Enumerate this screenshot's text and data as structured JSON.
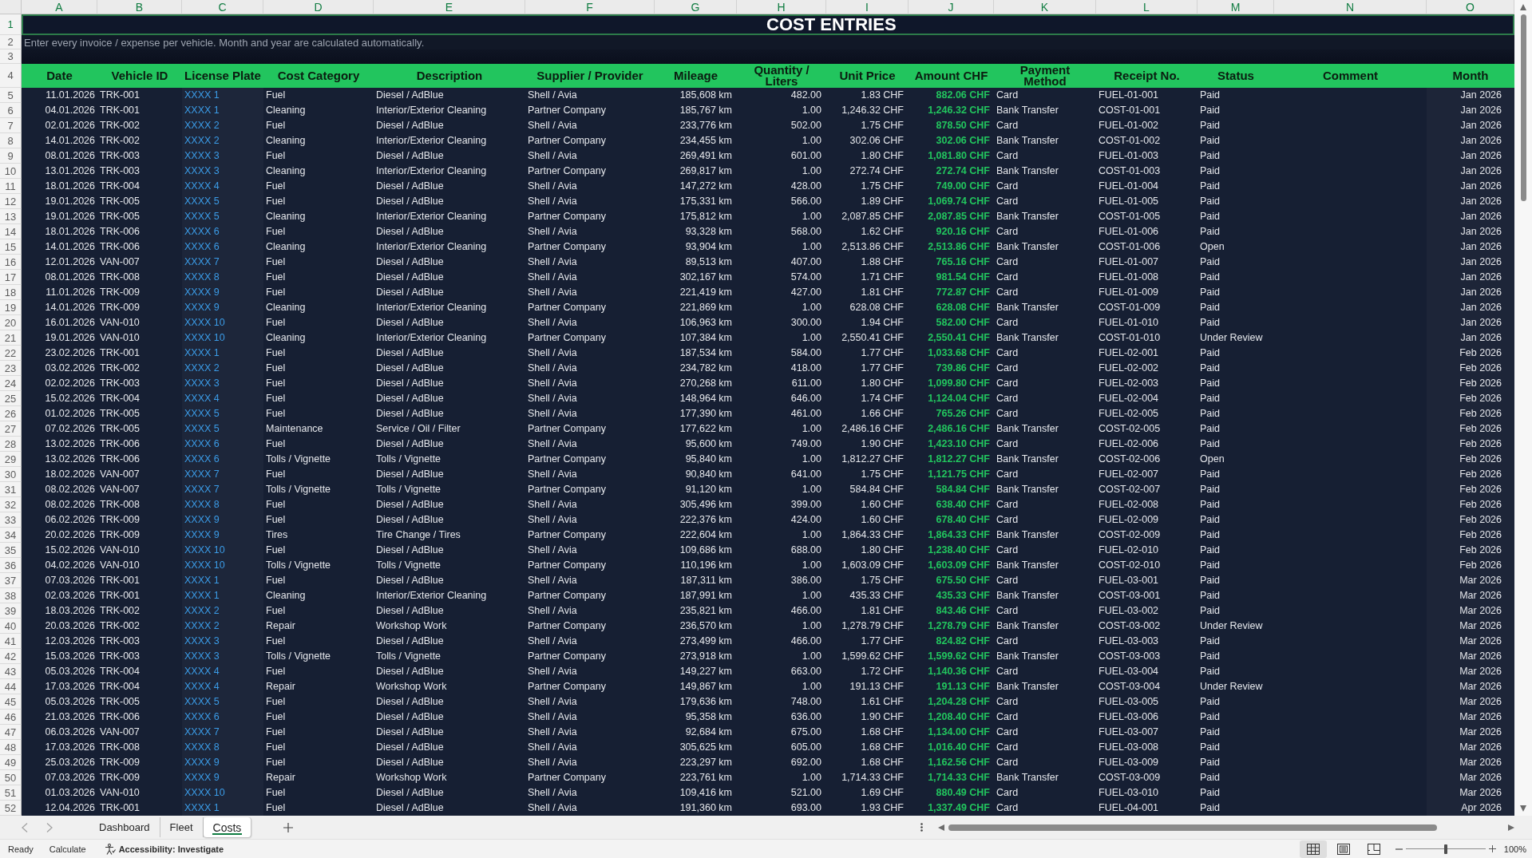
{
  "column_letters": [
    "A",
    "B",
    "C",
    "D",
    "E",
    "F",
    "G",
    "H",
    "I",
    "J",
    "K",
    "L",
    "M",
    "N",
    "O"
  ],
  "title_row": {
    "row_number": "1",
    "title": "COST ENTRIES"
  },
  "note_row": {
    "row_number": "2",
    "text": "Enter every invoice / expense per vehicle. Month and year are calculated automatically."
  },
  "spacer_row": {
    "row_number": "3"
  },
  "table": {
    "row_number": "4",
    "columns": [
      {
        "label": "Date",
        "kind": "date"
      },
      {
        "label": "Vehicle ID",
        "kind": "text"
      },
      {
        "label": "License Plate",
        "kind": "plate"
      },
      {
        "label": "Cost Category",
        "kind": "text"
      },
      {
        "label": "Description",
        "kind": "text"
      },
      {
        "label": "Supplier / Provider",
        "kind": "text"
      },
      {
        "label": "Mileage",
        "kind": "number"
      },
      {
        "label": "Quantity /\nLiters",
        "kind": "number"
      },
      {
        "label": "Unit Price",
        "kind": "number"
      },
      {
        "label": "Amount CHF",
        "kind": "amount"
      },
      {
        "label": "Payment\nMethod",
        "kind": "text"
      },
      {
        "label": "Receipt No.",
        "kind": "text"
      },
      {
        "label": "Status",
        "kind": "text"
      },
      {
        "label": "Comment",
        "kind": "blank"
      },
      {
        "label": "Month",
        "kind": "month"
      }
    ],
    "rows": [
      {
        "number": "5",
        "cells": [
          "11.01.2026",
          "TRK-001",
          "XXXX 1",
          "Fuel",
          "Diesel / AdBlue",
          "Shell / Avia",
          "185,608 km",
          "482.00",
          "1.83 CHF",
          "882.06 CHF",
          "Card",
          "FUEL-01-001",
          "Paid",
          "Jan 2026"
        ]
      },
      {
        "number": "6",
        "cells": [
          "04.01.2026",
          "TRK-001",
          "XXXX 1",
          "Cleaning",
          "Interior/Exterior Cleaning",
          "Partner Company",
          "185,767 km",
          "1.00",
          "1,246.32 CHF",
          "1,246.32 CHF",
          "Bank Transfer",
          "COST-01-001",
          "Paid",
          "Jan 2026"
        ]
      },
      {
        "number": "7",
        "cells": [
          "02.01.2026",
          "TRK-002",
          "XXXX 2",
          "Fuel",
          "Diesel / AdBlue",
          "Shell / Avia",
          "233,776 km",
          "502.00",
          "1.75 CHF",
          "878.50 CHF",
          "Card",
          "FUEL-01-002",
          "Paid",
          "Jan 2026"
        ]
      },
      {
        "number": "8",
        "cells": [
          "14.01.2026",
          "TRK-002",
          "XXXX 2",
          "Cleaning",
          "Interior/Exterior Cleaning",
          "Partner Company",
          "234,455 km",
          "1.00",
          "302.06 CHF",
          "302.06 CHF",
          "Bank Transfer",
          "COST-01-002",
          "Paid",
          "Jan 2026"
        ]
      },
      {
        "number": "9",
        "cells": [
          "08.01.2026",
          "TRK-003",
          "XXXX 3",
          "Fuel",
          "Diesel / AdBlue",
          "Shell / Avia",
          "269,491 km",
          "601.00",
          "1.80 CHF",
          "1,081.80 CHF",
          "Card",
          "FUEL-01-003",
          "Paid",
          "Jan 2026"
        ]
      },
      {
        "number": "10",
        "cells": [
          "13.01.2026",
          "TRK-003",
          "XXXX 3",
          "Cleaning",
          "Interior/Exterior Cleaning",
          "Partner Company",
          "269,817 km",
          "1.00",
          "272.74 CHF",
          "272.74 CHF",
          "Bank Transfer",
          "COST-01-003",
          "Paid",
          "Jan 2026"
        ]
      },
      {
        "number": "11",
        "cells": [
          "18.01.2026",
          "TRK-004",
          "XXXX 4",
          "Fuel",
          "Diesel / AdBlue",
          "Shell / Avia",
          "147,272 km",
          "428.00",
          "1.75 CHF",
          "749.00 CHF",
          "Card",
          "FUEL-01-004",
          "Paid",
          "Jan 2026"
        ]
      },
      {
        "number": "12",
        "cells": [
          "19.01.2026",
          "TRK-005",
          "XXXX 5",
          "Fuel",
          "Diesel / AdBlue",
          "Shell / Avia",
          "175,331 km",
          "566.00",
          "1.89 CHF",
          "1,069.74 CHF",
          "Card",
          "FUEL-01-005",
          "Paid",
          "Jan 2026"
        ]
      },
      {
        "number": "13",
        "cells": [
          "19.01.2026",
          "TRK-005",
          "XXXX 5",
          "Cleaning",
          "Interior/Exterior Cleaning",
          "Partner Company",
          "175,812 km",
          "1.00",
          "2,087.85 CHF",
          "2,087.85 CHF",
          "Bank Transfer",
          "COST-01-005",
          "Paid",
          "Jan 2026"
        ]
      },
      {
        "number": "14",
        "cells": [
          "18.01.2026",
          "TRK-006",
          "XXXX 6",
          "Fuel",
          "Diesel / AdBlue",
          "Shell / Avia",
          "93,328 km",
          "568.00",
          "1.62 CHF",
          "920.16 CHF",
          "Card",
          "FUEL-01-006",
          "Paid",
          "Jan 2026"
        ]
      },
      {
        "number": "15",
        "cells": [
          "14.01.2026",
          "TRK-006",
          "XXXX 6",
          "Cleaning",
          "Interior/Exterior Cleaning",
          "Partner Company",
          "93,904 km",
          "1.00",
          "2,513.86 CHF",
          "2,513.86 CHF",
          "Bank Transfer",
          "COST-01-006",
          "Open",
          "Jan 2026"
        ]
      },
      {
        "number": "16",
        "cells": [
          "12.01.2026",
          "VAN-007",
          "XXXX 7",
          "Fuel",
          "Diesel / AdBlue",
          "Shell / Avia",
          "89,513 km",
          "407.00",
          "1.88 CHF",
          "765.16 CHF",
          "Card",
          "FUEL-01-007",
          "Paid",
          "Jan 2026"
        ]
      },
      {
        "number": "17",
        "cells": [
          "08.01.2026",
          "TRK-008",
          "XXXX 8",
          "Fuel",
          "Diesel / AdBlue",
          "Shell / Avia",
          "302,167 km",
          "574.00",
          "1.71 CHF",
          "981.54 CHF",
          "Card",
          "FUEL-01-008",
          "Paid",
          "Jan 2026"
        ]
      },
      {
        "number": "18",
        "cells": [
          "11.01.2026",
          "TRK-009",
          "XXXX 9",
          "Fuel",
          "Diesel / AdBlue",
          "Shell / Avia",
          "221,419 km",
          "427.00",
          "1.81 CHF",
          "772.87 CHF",
          "Card",
          "FUEL-01-009",
          "Paid",
          "Jan 2026"
        ]
      },
      {
        "number": "19",
        "cells": [
          "14.01.2026",
          "TRK-009",
          "XXXX 9",
          "Cleaning",
          "Interior/Exterior Cleaning",
          "Partner Company",
          "221,869 km",
          "1.00",
          "628.08 CHF",
          "628.08 CHF",
          "Bank Transfer",
          "COST-01-009",
          "Paid",
          "Jan 2026"
        ]
      },
      {
        "number": "20",
        "cells": [
          "16.01.2026",
          "VAN-010",
          "XXXX 10",
          "Fuel",
          "Diesel / AdBlue",
          "Shell / Avia",
          "106,963 km",
          "300.00",
          "1.94 CHF",
          "582.00 CHF",
          "Card",
          "FUEL-01-010",
          "Paid",
          "Jan 2026"
        ]
      },
      {
        "number": "21",
        "cells": [
          "19.01.2026",
          "VAN-010",
          "XXXX 10",
          "Cleaning",
          "Interior/Exterior Cleaning",
          "Partner Company",
          "107,384 km",
          "1.00",
          "2,550.41 CHF",
          "2,550.41 CHF",
          "Bank Transfer",
          "COST-01-010",
          "Under Review",
          "Jan 2026"
        ]
      },
      {
        "number": "22",
        "cells": [
          "23.02.2026",
          "TRK-001",
          "XXXX 1",
          "Fuel",
          "Diesel / AdBlue",
          "Shell / Avia",
          "187,534 km",
          "584.00",
          "1.77 CHF",
          "1,033.68 CHF",
          "Card",
          "FUEL-02-001",
          "Paid",
          "Feb 2026"
        ]
      },
      {
        "number": "23",
        "cells": [
          "03.02.2026",
          "TRK-002",
          "XXXX 2",
          "Fuel",
          "Diesel / AdBlue",
          "Shell / Avia",
          "234,782 km",
          "418.00",
          "1.77 CHF",
          "739.86 CHF",
          "Card",
          "FUEL-02-002",
          "Paid",
          "Feb 2026"
        ]
      },
      {
        "number": "24",
        "cells": [
          "02.02.2026",
          "TRK-003",
          "XXXX 3",
          "Fuel",
          "Diesel / AdBlue",
          "Shell / Avia",
          "270,268 km",
          "611.00",
          "1.80 CHF",
          "1,099.80 CHF",
          "Card",
          "FUEL-02-003",
          "Paid",
          "Feb 2026"
        ]
      },
      {
        "number": "25",
        "cells": [
          "15.02.2026",
          "TRK-004",
          "XXXX 4",
          "Fuel",
          "Diesel / AdBlue",
          "Shell / Avia",
          "148,964 km",
          "646.00",
          "1.74 CHF",
          "1,124.04 CHF",
          "Card",
          "FUEL-02-004",
          "Paid",
          "Feb 2026"
        ]
      },
      {
        "number": "26",
        "cells": [
          "01.02.2026",
          "TRK-005",
          "XXXX 5",
          "Fuel",
          "Diesel / AdBlue",
          "Shell / Avia",
          "177,390 km",
          "461.00",
          "1.66 CHF",
          "765.26 CHF",
          "Card",
          "FUEL-02-005",
          "Paid",
          "Feb 2026"
        ]
      },
      {
        "number": "27",
        "cells": [
          "07.02.2026",
          "TRK-005",
          "XXXX 5",
          "Maintenance",
          "Service / Oil / Filter",
          "Partner Company",
          "177,622 km",
          "1.00",
          "2,486.16 CHF",
          "2,486.16 CHF",
          "Bank Transfer",
          "COST-02-005",
          "Paid",
          "Feb 2026"
        ]
      },
      {
        "number": "28",
        "cells": [
          "13.02.2026",
          "TRK-006",
          "XXXX 6",
          "Fuel",
          "Diesel / AdBlue",
          "Shell / Avia",
          "95,600 km",
          "749.00",
          "1.90 CHF",
          "1,423.10 CHF",
          "Card",
          "FUEL-02-006",
          "Paid",
          "Feb 2026"
        ]
      },
      {
        "number": "29",
        "cells": [
          "13.02.2026",
          "TRK-006",
          "XXXX 6",
          "Tolls / Vignette",
          "Tolls / Vignette",
          "Partner Company",
          "95,840 km",
          "1.00",
          "1,812.27 CHF",
          "1,812.27 CHF",
          "Bank Transfer",
          "COST-02-006",
          "Open",
          "Feb 2026"
        ]
      },
      {
        "number": "30",
        "cells": [
          "18.02.2026",
          "VAN-007",
          "XXXX 7",
          "Fuel",
          "Diesel / AdBlue",
          "Shell / Avia",
          "90,840 km",
          "641.00",
          "1.75 CHF",
          "1,121.75 CHF",
          "Card",
          "FUEL-02-007",
          "Paid",
          "Feb 2026"
        ]
      },
      {
        "number": "31",
        "cells": [
          "08.02.2026",
          "VAN-007",
          "XXXX 7",
          "Tolls / Vignette",
          "Tolls / Vignette",
          "Partner Company",
          "91,120 km",
          "1.00",
          "584.84 CHF",
          "584.84 CHF",
          "Bank Transfer",
          "COST-02-007",
          "Paid",
          "Feb 2026"
        ]
      },
      {
        "number": "32",
        "cells": [
          "08.02.2026",
          "TRK-008",
          "XXXX 8",
          "Fuel",
          "Diesel / AdBlue",
          "Shell / Avia",
          "305,496 km",
          "399.00",
          "1.60 CHF",
          "638.40 CHF",
          "Card",
          "FUEL-02-008",
          "Paid",
          "Feb 2026"
        ]
      },
      {
        "number": "33",
        "cells": [
          "06.02.2026",
          "TRK-009",
          "XXXX 9",
          "Fuel",
          "Diesel / AdBlue",
          "Shell / Avia",
          "222,376 km",
          "424.00",
          "1.60 CHF",
          "678.40 CHF",
          "Card",
          "FUEL-02-009",
          "Paid",
          "Feb 2026"
        ]
      },
      {
        "number": "34",
        "cells": [
          "20.02.2026",
          "TRK-009",
          "XXXX 9",
          "Tires",
          "Tire Change / Tires",
          "Partner Company",
          "222,604 km",
          "1.00",
          "1,864.33 CHF",
          "1,864.33 CHF",
          "Bank Transfer",
          "COST-02-009",
          "Paid",
          "Feb 2026"
        ]
      },
      {
        "number": "35",
        "cells": [
          "15.02.2026",
          "VAN-010",
          "XXXX 10",
          "Fuel",
          "Diesel / AdBlue",
          "Shell / Avia",
          "109,686 km",
          "688.00",
          "1.80 CHF",
          "1,238.40 CHF",
          "Card",
          "FUEL-02-010",
          "Paid",
          "Feb 2026"
        ]
      },
      {
        "number": "36",
        "cells": [
          "04.02.2026",
          "VAN-010",
          "XXXX 10",
          "Tolls / Vignette",
          "Tolls / Vignette",
          "Partner Company",
          "110,196 km",
          "1.00",
          "1,603.09 CHF",
          "1,603.09 CHF",
          "Bank Transfer",
          "COST-02-010",
          "Paid",
          "Feb 2026"
        ]
      },
      {
        "number": "37",
        "cells": [
          "07.03.2026",
          "TRK-001",
          "XXXX 1",
          "Fuel",
          "Diesel / AdBlue",
          "Shell / Avia",
          "187,311 km",
          "386.00",
          "1.75 CHF",
          "675.50 CHF",
          "Card",
          "FUEL-03-001",
          "Paid",
          "Mar 2026"
        ]
      },
      {
        "number": "38",
        "cells": [
          "02.03.2026",
          "TRK-001",
          "XXXX 1",
          "Cleaning",
          "Interior/Exterior Cleaning",
          "Partner Company",
          "187,991 km",
          "1.00",
          "435.33 CHF",
          "435.33 CHF",
          "Bank Transfer",
          "COST-03-001",
          "Paid",
          "Mar 2026"
        ]
      },
      {
        "number": "39",
        "cells": [
          "18.03.2026",
          "TRK-002",
          "XXXX 2",
          "Fuel",
          "Diesel / AdBlue",
          "Shell / Avia",
          "235,821 km",
          "466.00",
          "1.81 CHF",
          "843.46 CHF",
          "Card",
          "FUEL-03-002",
          "Paid",
          "Mar 2026"
        ]
      },
      {
        "number": "40",
        "cells": [
          "20.03.2026",
          "TRK-002",
          "XXXX 2",
          "Repair",
          "Workshop Work",
          "Partner Company",
          "236,570 km",
          "1.00",
          "1,278.79 CHF",
          "1,278.79 CHF",
          "Bank Transfer",
          "COST-03-002",
          "Under Review",
          "Mar 2026"
        ]
      },
      {
        "number": "41",
        "cells": [
          "12.03.2026",
          "TRK-003",
          "XXXX 3",
          "Fuel",
          "Diesel / AdBlue",
          "Shell / Avia",
          "273,499 km",
          "466.00",
          "1.77 CHF",
          "824.82 CHF",
          "Card",
          "FUEL-03-003",
          "Paid",
          "Mar 2026"
        ]
      },
      {
        "number": "42",
        "cells": [
          "15.03.2026",
          "TRK-003",
          "XXXX 3",
          "Tolls / Vignette",
          "Tolls / Vignette",
          "Partner Company",
          "273,918 km",
          "1.00",
          "1,599.62 CHF",
          "1,599.62 CHF",
          "Bank Transfer",
          "COST-03-003",
          "Paid",
          "Mar 2026"
        ]
      },
      {
        "number": "43",
        "cells": [
          "05.03.2026",
          "TRK-004",
          "XXXX 4",
          "Fuel",
          "Diesel / AdBlue",
          "Shell / Avia",
          "149,227 km",
          "663.00",
          "1.72 CHF",
          "1,140.36 CHF",
          "Card",
          "FUEL-03-004",
          "Paid",
          "Mar 2026"
        ]
      },
      {
        "number": "44",
        "cells": [
          "17.03.2026",
          "TRK-004",
          "XXXX 4",
          "Repair",
          "Workshop Work",
          "Partner Company",
          "149,867 km",
          "1.00",
          "191.13 CHF",
          "191.13 CHF",
          "Bank Transfer",
          "COST-03-004",
          "Under Review",
          "Mar 2026"
        ]
      },
      {
        "number": "45",
        "cells": [
          "05.03.2026",
          "TRK-005",
          "XXXX 5",
          "Fuel",
          "Diesel / AdBlue",
          "Shell / Avia",
          "179,636 km",
          "748.00",
          "1.61 CHF",
          "1,204.28 CHF",
          "Card",
          "FUEL-03-005",
          "Paid",
          "Mar 2026"
        ]
      },
      {
        "number": "46",
        "cells": [
          "21.03.2026",
          "TRK-006",
          "XXXX 6",
          "Fuel",
          "Diesel / AdBlue",
          "Shell / Avia",
          "95,358 km",
          "636.00",
          "1.90 CHF",
          "1,208.40 CHF",
          "Card",
          "FUEL-03-006",
          "Paid",
          "Mar 2026"
        ]
      },
      {
        "number": "47",
        "cells": [
          "06.03.2026",
          "VAN-007",
          "XXXX 7",
          "Fuel",
          "Diesel / AdBlue",
          "Shell / Avia",
          "92,684 km",
          "675.00",
          "1.68 CHF",
          "1,134.00 CHF",
          "Card",
          "FUEL-03-007",
          "Paid",
          "Mar 2026"
        ]
      },
      {
        "number": "48",
        "cells": [
          "17.03.2026",
          "TRK-008",
          "XXXX 8",
          "Fuel",
          "Diesel / AdBlue",
          "Shell / Avia",
          "305,625 km",
          "605.00",
          "1.68 CHF",
          "1,016.40 CHF",
          "Card",
          "FUEL-03-008",
          "Paid",
          "Mar 2026"
        ]
      },
      {
        "number": "49",
        "cells": [
          "25.03.2026",
          "TRK-009",
          "XXXX 9",
          "Fuel",
          "Diesel / AdBlue",
          "Shell / Avia",
          "223,297 km",
          "692.00",
          "1.68 CHF",
          "1,162.56 CHF",
          "Card",
          "FUEL-03-009",
          "Paid",
          "Mar 2026"
        ]
      },
      {
        "number": "50",
        "cells": [
          "07.03.2026",
          "TRK-009",
          "XXXX 9",
          "Repair",
          "Workshop Work",
          "Partner Company",
          "223,761 km",
          "1.00",
          "1,714.33 CHF",
          "1,714.33 CHF",
          "Bank Transfer",
          "COST-03-009",
          "Paid",
          "Mar 2026"
        ]
      },
      {
        "number": "51",
        "cells": [
          "01.03.2026",
          "VAN-010",
          "XXXX 10",
          "Fuel",
          "Diesel / AdBlue",
          "Shell / Avia",
          "109,416 km",
          "521.00",
          "1.69 CHF",
          "880.49 CHF",
          "Card",
          "FUEL-03-010",
          "Paid",
          "Mar 2026"
        ]
      },
      {
        "number": "52",
        "cells": [
          "12.04.2026",
          "TRK-001",
          "XXXX 1",
          "Fuel",
          "Diesel / AdBlue",
          "Shell / Avia",
          "191,360 km",
          "693.00",
          "1.93 CHF",
          "1,337.49 CHF",
          "Card",
          "FUEL-04-001",
          "Paid",
          "Apr 2026"
        ]
      }
    ]
  },
  "sheet_tabs": [
    {
      "label": "Dashboard",
      "selected": false
    },
    {
      "label": "Fleet",
      "selected": false
    },
    {
      "label": "Costs",
      "selected": true
    }
  ],
  "status_bar": {
    "mode": "Ready",
    "calculate": "Calculate",
    "accessibility": "Accessibility: Investigate",
    "views": [
      {
        "kind": "normal",
        "selected": true
      },
      {
        "kind": "page_layout",
        "selected": false
      },
      {
        "kind": "page_break",
        "selected": false
      }
    ],
    "zoom_slider": {
      "level": 0.5
    },
    "zoom": "100%"
  }
}
